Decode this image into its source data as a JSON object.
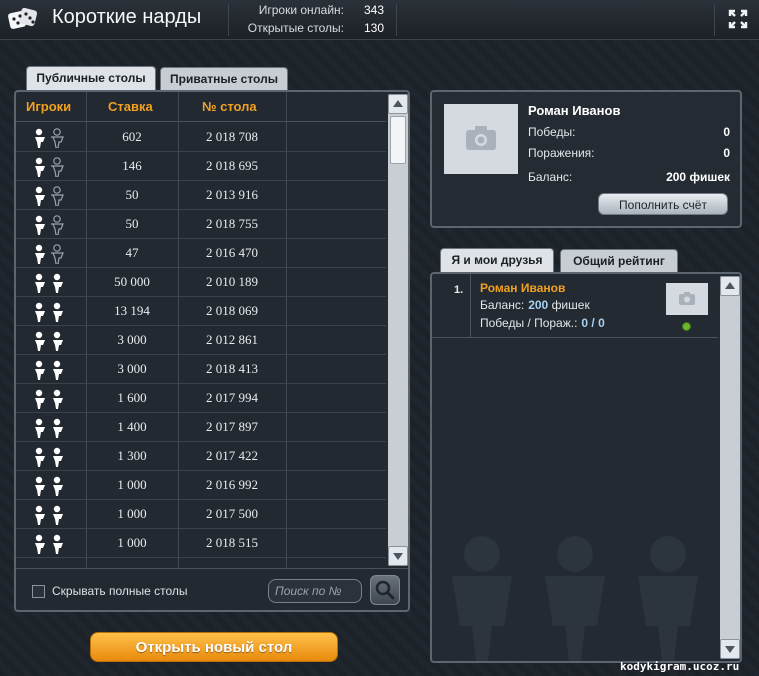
{
  "header": {
    "title": "Короткие нарды",
    "online_label": "Игроки онлайн:",
    "online_value": "343",
    "open_tables_label": "Открытые столы:",
    "open_tables_value": "130"
  },
  "tabs": {
    "public": "Публичные столы",
    "private": "Приватные столы"
  },
  "tables": {
    "columns": [
      "Игроки",
      "Ставка",
      "№ стола"
    ],
    "rows": [
      {
        "players": 1,
        "bet": "602",
        "number": "2 018 708"
      },
      {
        "players": 1,
        "bet": "146",
        "number": "2 018 695"
      },
      {
        "players": 1,
        "bet": "50",
        "number": "2 013 916"
      },
      {
        "players": 1,
        "bet": "50",
        "number": "2 018 755"
      },
      {
        "players": 1,
        "bet": "47",
        "number": "2 016 470"
      },
      {
        "players": 2,
        "bet": "50 000",
        "number": "2 010 189"
      },
      {
        "players": 2,
        "bet": "13 194",
        "number": "2 018 069"
      },
      {
        "players": 2,
        "bet": "3 000",
        "number": "2 012 861"
      },
      {
        "players": 2,
        "bet": "3 000",
        "number": "2 018 413"
      },
      {
        "players": 2,
        "bet": "1 600",
        "number": "2 017 994"
      },
      {
        "players": 2,
        "bet": "1 400",
        "number": "2 017 897"
      },
      {
        "players": 2,
        "bet": "1 300",
        "number": "2 017 422"
      },
      {
        "players": 2,
        "bet": "1 000",
        "number": "2 016 992"
      },
      {
        "players": 2,
        "bet": "1 000",
        "number": "2 017 500"
      },
      {
        "players": 2,
        "bet": "1 000",
        "number": "2 018 515"
      }
    ],
    "hide_full_label": "Скрывать полные столы",
    "search_placeholder": "Поиск по №"
  },
  "open_table_button": "Открыть новый стол",
  "profile": {
    "name": "Роман Иванов",
    "wins_label": "Победы:",
    "wins_value": "0",
    "losses_label": "Поражения:",
    "losses_value": "0",
    "balance_label": "Баланс:",
    "balance_value": "200",
    "balance_unit": "фишек",
    "topup_button": "Пополнить счёт"
  },
  "friends_tabs": {
    "mine": "Я и мои друзья",
    "rating": "Общий рейтинг"
  },
  "friends": [
    {
      "rank": "1.",
      "name": "Роман Иванов",
      "balance_label": "Баланс:",
      "balance_value": "200",
      "balance_unit": "фишек",
      "record_label": "Победы / Пораж.:",
      "record_value": "0 / 0"
    }
  ],
  "watermark": "kodykigram.ucoz.ru",
  "colors": {
    "accent_orange": "#f0a122",
    "online_green": "#6cb52c"
  }
}
